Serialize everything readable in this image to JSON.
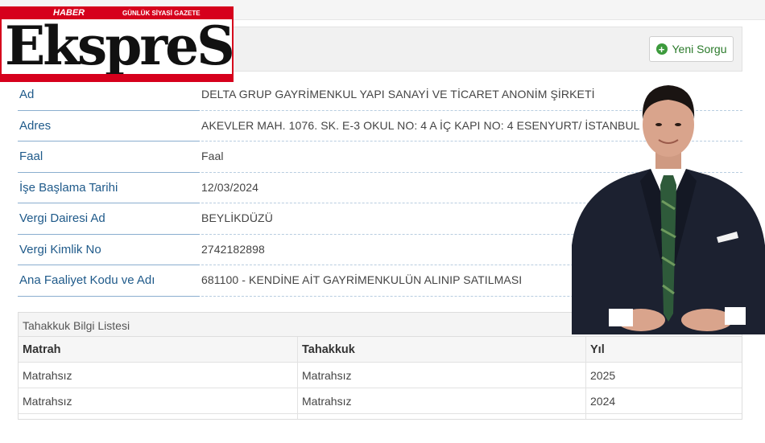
{
  "logo": {
    "top_label": "HABER",
    "tagline": "GÜNLÜK SİYASİ GAZETE",
    "wordmark": "EkspreSS"
  },
  "toolbar": {
    "new_query_label": "Yeni Sorgu"
  },
  "info_rows": [
    {
      "label": "Ad",
      "value": "DELTA GRUP GAYRİMENKUL YAPI SANAYİ VE TİCARET ANONİM ŞİRKETİ"
    },
    {
      "label": "Adres",
      "value": "AKEVLER MAH. 1076. SK. E-3 OKUL NO: 4 A İÇ KAPI NO: 4 ESENYURT/ İSTANBUL"
    },
    {
      "label": "Faal",
      "value": "Faal"
    },
    {
      "label": "İşe Başlama Tarihi",
      "value": "12/03/2024"
    },
    {
      "label": "Vergi Dairesi Ad",
      "value": "BEYLİKDÜZÜ"
    },
    {
      "label": "Vergi Kimlik No",
      "value": "2742182898"
    },
    {
      "label": "Ana Faaliyet Kodu ve Adı",
      "value": "681100 - KENDİNE AİT GAYRİMENKULÜN ALINIP SATILMASI"
    }
  ],
  "tahakkuk": {
    "title": "Tahakkuk Bilgi Listesi",
    "columns": [
      "Matrah",
      "Tahakkuk",
      "Yıl"
    ],
    "rows": [
      [
        "Matrahsız",
        "Matrahsız",
        "2025"
      ],
      [
        "Matrahsız",
        "Matrahsız",
        "2024"
      ]
    ]
  },
  "colors": {
    "brand_red": "#d6001c",
    "label_blue": "#1f5a8a",
    "button_green": "#3c9a3c"
  }
}
